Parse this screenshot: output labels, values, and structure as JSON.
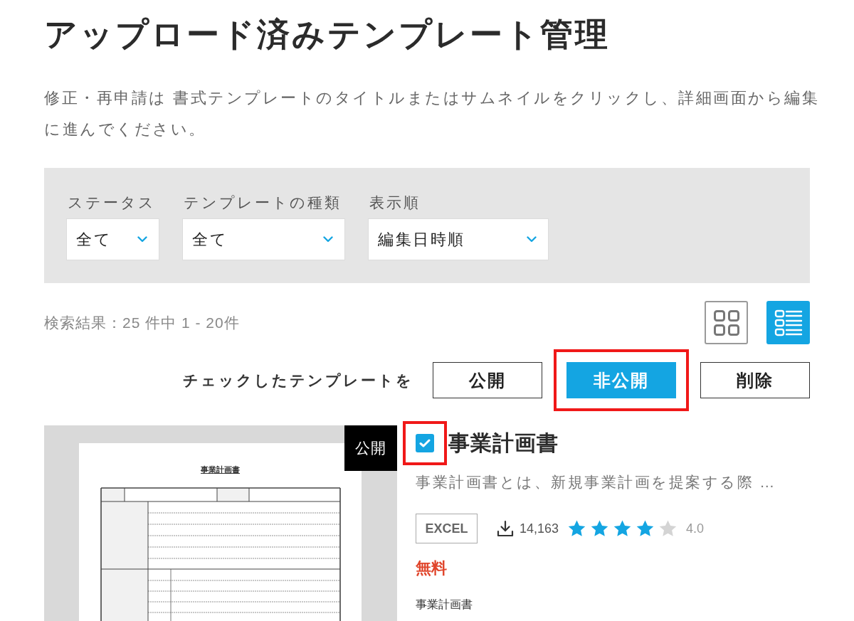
{
  "page": {
    "title": "アップロード済みテンプレート管理",
    "description": "修正・再申請は 書式テンプレートのタイトルまたはサムネイルをクリックし、詳細画面から編集に進んでください。"
  },
  "filters": [
    {
      "label": "ステータス",
      "value": "全て"
    },
    {
      "label": "テンプレートの種類",
      "value": "全て"
    },
    {
      "label": "表示順",
      "value": "編集日時順"
    }
  ],
  "results": {
    "summary": "検索結果：25 件中 1 - 20件"
  },
  "view_modes": [
    {
      "kind": "grid",
      "selected": false
    },
    {
      "kind": "list",
      "selected": true
    }
  ],
  "bulk_actions": {
    "label": "チェックしたテンプレートを",
    "buttons": [
      {
        "label": "公開",
        "kind": "outline",
        "highlighted": false
      },
      {
        "label": "非公開",
        "kind": "primary",
        "highlighted": true
      },
      {
        "label": "削除",
        "kind": "outline",
        "highlighted": false
      }
    ]
  },
  "templates": [
    {
      "status": "公開",
      "thumbnail": {
        "title": "事業計画書"
      },
      "checked": true,
      "highlighted": true,
      "title": "事業計画書",
      "description": "事業計画書とは、新規事業計画を提案する際 …",
      "file_type": "EXCEL",
      "downloads": "14,163",
      "stars": 4,
      "rating": "4.0",
      "price": "無料",
      "tags": [
        "事業計画書"
      ]
    }
  ]
}
